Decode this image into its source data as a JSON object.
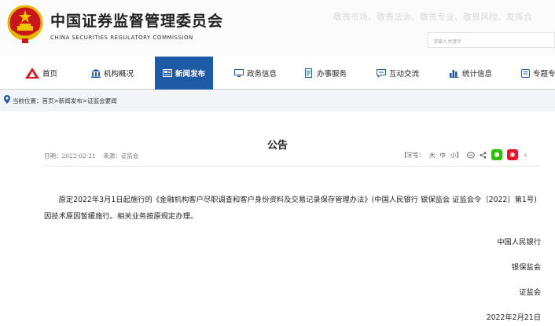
{
  "header": {
    "title_cn": "中国证券监督管理委员会",
    "title_en": "CHINA SECURITIES REGULATORY COMMISSION",
    "slogan": "敬畏市场、敬畏法治、敬畏专业、敬畏风险、发挥合",
    "search_placeholder": "请输入关键字"
  },
  "nav": {
    "items": [
      {
        "label": "首页",
        "icon": "home-logo-icon"
      },
      {
        "label": "机构概况",
        "icon": "building-icon"
      },
      {
        "label": "新闻发布",
        "icon": "news-icon",
        "active": true
      },
      {
        "label": "政务信息",
        "icon": "monitor-icon"
      },
      {
        "label": "办事服务",
        "icon": "document-icon"
      },
      {
        "label": "互动交流",
        "icon": "chat-icon"
      },
      {
        "label": "统计信息",
        "icon": "bar-chart-icon"
      },
      {
        "label": "专题专",
        "icon": "folder-icon"
      }
    ],
    "active_color": "#1f5aa7"
  },
  "breadcrumb": {
    "prefix": "当前位置：",
    "path": "首页>新闻发布>证监会要闻"
  },
  "article": {
    "title": "公告",
    "date_label": "日期：",
    "date": "2022-02-21",
    "source_label": "来源：",
    "source": "证监会",
    "font_label": "【字号：",
    "size_large": "大",
    "size_medium": "中",
    "size_small": "小】",
    "body": "原定2022年3月1日起施行的《金融机构客户尽职调查和客户身份资料及交易记录保存管理办法》(中国人民银行 银保监会 证监会令〔2022〕第1号)因技术原因暂缓施行。相关业务按原规定办理。",
    "signatures": [
      "中国人民银行",
      "银保监会",
      "证监会",
      "2022年2月21日"
    ]
  }
}
